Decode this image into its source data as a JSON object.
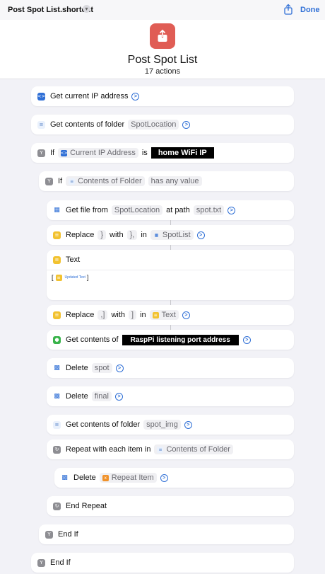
{
  "topbar": {
    "title": "Post Spot List.shortcut",
    "done_label": "Done",
    "chevron": "chevron-down-icon",
    "share_icon": "share-icon"
  },
  "header": {
    "name": "Post Spot List",
    "count": "17 actions",
    "icon": "share-icon",
    "icon_color": "#e05d55"
  },
  "colors": {
    "accent": "#2f6fd6",
    "background": "#f2f2f7",
    "card": "#ffffff"
  },
  "actions": {
    "get_ip": {
      "label": "Get current IP address"
    },
    "get_folder": {
      "label": "Get contents of folder",
      "folder": "SpotLocation"
    },
    "if1": {
      "keyword": "If",
      "variable": "Current IP Address",
      "op": "is",
      "value": "home WiFi IP"
    },
    "if2": {
      "keyword": "If",
      "variable": "Contents of Folder",
      "condition": "has any value"
    },
    "get_file": {
      "label": "Get file from",
      "folder": "SpotLocation",
      "path_label": "at path",
      "path": "spot.txt"
    },
    "replace1": {
      "label": "Replace",
      "find": "}",
      "with_label": "with",
      "replace": "},",
      "in_label": "in",
      "target": "SpotList"
    },
    "text": {
      "label": "Text",
      "open": "[",
      "var": "Updated Text",
      "close": "]"
    },
    "replace2": {
      "label": "Replace",
      "find": ",]",
      "with_label": "with",
      "replace": "]",
      "in_label": "in",
      "target": "Text"
    },
    "get_url": {
      "label": "Get contents of",
      "url": "RaspPi listening port address"
    },
    "delete1": {
      "label": "Delete",
      "item": "spot"
    },
    "delete2": {
      "label": "Delete",
      "item": "final"
    },
    "get_folder2": {
      "label": "Get contents of folder",
      "folder": "spot_img"
    },
    "repeat": {
      "label": "Repeat with each item in",
      "source": "Contents of Folder"
    },
    "delete3": {
      "label": "Delete",
      "item": "Repeat Item"
    },
    "end_repeat": {
      "label": "End Repeat"
    },
    "end_if2": {
      "label": "End If"
    },
    "end_if1": {
      "label": "End If"
    }
  }
}
